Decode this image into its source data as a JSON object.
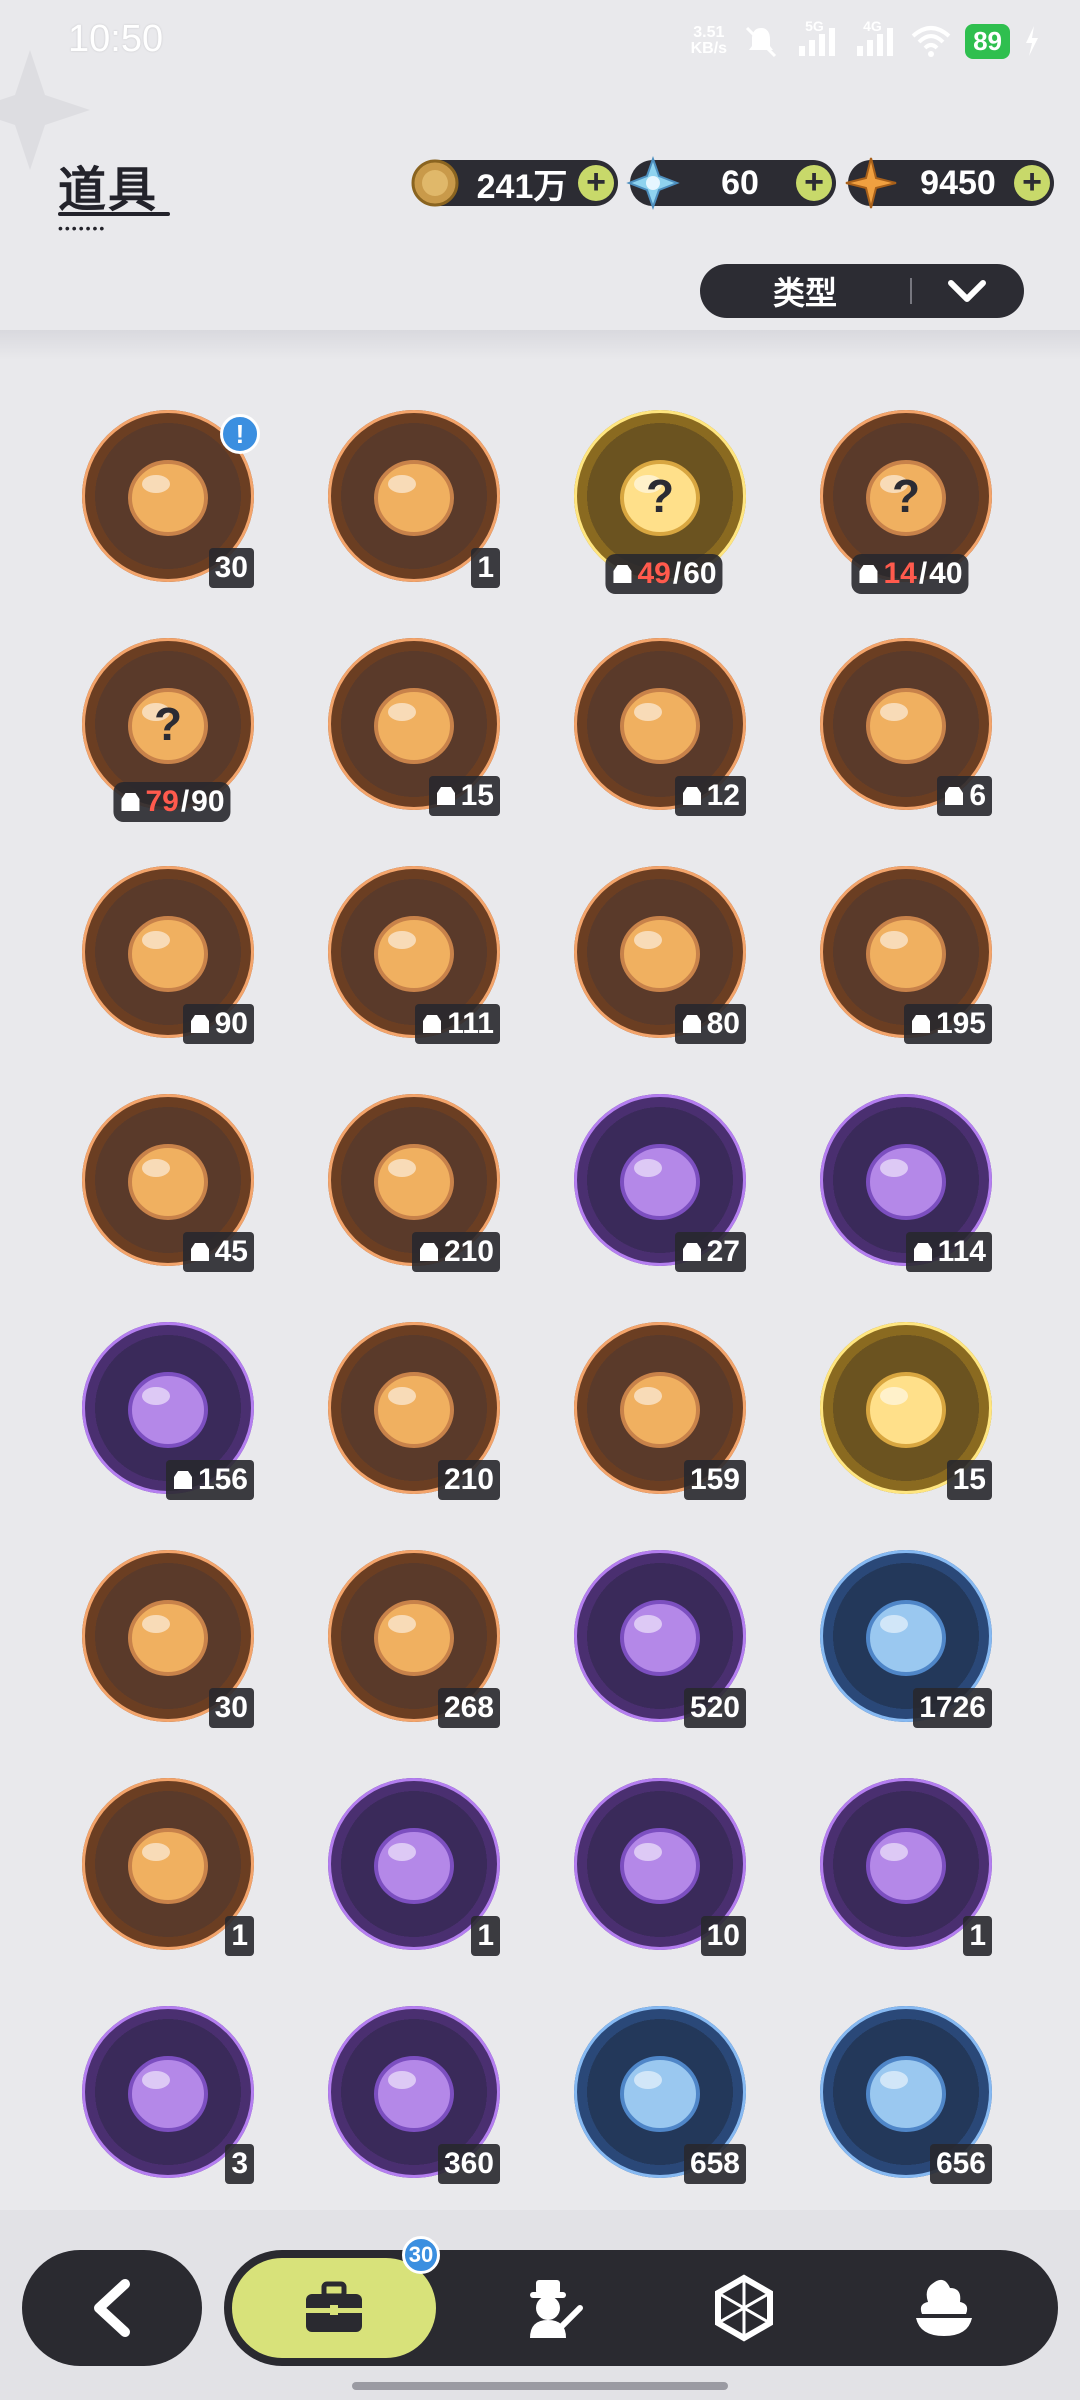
{
  "status_bar": {
    "time": "10:50",
    "net_speed_value": "3.51",
    "net_speed_unit": "KB/s",
    "network_5g": "5G",
    "network_4g": "4G",
    "battery": "89"
  },
  "header": {
    "title": "道具",
    "currencies": [
      {
        "icon": "coin-icon",
        "value": "241万"
      },
      {
        "icon": "crystal-icon",
        "value": "60"
      },
      {
        "icon": "star-shard-icon",
        "value": "9450"
      }
    ],
    "filter_label": "类型"
  },
  "items": [
    {
      "name": "treasure-chest",
      "rarity": "orange",
      "count": "30",
      "fragment": false,
      "alert": true
    },
    {
      "name": "purple-crystal-tablet",
      "rarity": "orange",
      "count": "1",
      "fragment": false
    },
    {
      "name": "mystery-pet-gold",
      "rarity": "gold",
      "owned": "49",
      "required": "60",
      "fragment": true
    },
    {
      "name": "mystery-pet-orange",
      "rarity": "orange",
      "owned": "14",
      "required": "40",
      "fragment": true
    },
    {
      "name": "mystery-pet-brown",
      "rarity": "orange",
      "owned": "79",
      "required": "90",
      "fragment": true
    },
    {
      "name": "white-chick-pet",
      "rarity": "orange",
      "count": "15",
      "fragment": true
    },
    {
      "name": "teal-bird-pet",
      "rarity": "orange",
      "count": "12",
      "fragment": true
    },
    {
      "name": "white-red-cat-pet",
      "rarity": "orange",
      "count": "6",
      "fragment": true
    },
    {
      "name": "brown-bear-pet",
      "rarity": "orange",
      "count": "90",
      "fragment": true
    },
    {
      "name": "knight-helmet-pet",
      "rarity": "orange",
      "count": "111",
      "fragment": true
    },
    {
      "name": "white-cat-pet",
      "rarity": "orange",
      "count": "80",
      "fragment": true
    },
    {
      "name": "striped-cat-pet",
      "rarity": "orange",
      "count": "195",
      "fragment": true
    },
    {
      "name": "dark-bear-pet",
      "rarity": "orange",
      "count": "45",
      "fragment": true
    },
    {
      "name": "lilac-cat-pet",
      "rarity": "orange",
      "count": "210",
      "fragment": true
    },
    {
      "name": "leaf-sprout-pet",
      "rarity": "purple",
      "count": "27",
      "fragment": true
    },
    {
      "name": "brown-boar-pet",
      "rarity": "purple",
      "count": "114",
      "fragment": true
    },
    {
      "name": "yellow-blob-pet",
      "rarity": "purple",
      "count": "156",
      "fragment": true
    },
    {
      "name": "pink-star-crystal",
      "rarity": "orange",
      "count": "210",
      "fragment": false
    },
    {
      "name": "blue-star-crystal",
      "rarity": "orange",
      "count": "159",
      "fragment": false
    },
    {
      "name": "golden-character-card",
      "rarity": "gold",
      "count": "15",
      "fragment": false
    },
    {
      "name": "rainbow-character-card",
      "rarity": "orange",
      "count": "30",
      "fragment": false
    },
    {
      "name": "orange-character-card",
      "rarity": "orange",
      "count": "268",
      "fragment": false
    },
    {
      "name": "purple-character-card",
      "rarity": "purple",
      "count": "520",
      "fragment": false
    },
    {
      "name": "blue-character-card",
      "rarity": "blue",
      "count": "1726",
      "fragment": false
    },
    {
      "name": "spell-book",
      "rarity": "orange",
      "count": "1",
      "fragment": false
    },
    {
      "name": "gift-box",
      "rarity": "purple",
      "count": "1",
      "fragment": false
    },
    {
      "name": "golden-helmet",
      "rarity": "purple",
      "count": "10",
      "fragment": false
    },
    {
      "name": "magic-mirror",
      "rarity": "purple",
      "count": "1",
      "fragment": false
    },
    {
      "name": "scroll",
      "rarity": "purple",
      "count": "3",
      "fragment": false
    },
    {
      "name": "peach-fruit",
      "rarity": "purple",
      "count": "360",
      "fragment": false
    },
    {
      "name": "shovel",
      "rarity": "blue",
      "count": "658",
      "fragment": false
    },
    {
      "name": "boxing-glove",
      "rarity": "blue",
      "count": "656",
      "fragment": false
    }
  ],
  "bottom_nav": {
    "tabs": [
      {
        "icon": "bag-icon",
        "active": true
      },
      {
        "icon": "character-icon",
        "active": false
      },
      {
        "icon": "hexagon-crystal-icon",
        "active": false
      },
      {
        "icon": "dessert-icon",
        "active": false
      }
    ],
    "bag_badge": "30"
  },
  "colors": {
    "orange": "#e8792d",
    "purple": "#8b44d6",
    "gold": "#f3cc2f",
    "blue": "#3f86d8",
    "accent_green": "#d8e27a",
    "dark": "#2a2a30"
  }
}
